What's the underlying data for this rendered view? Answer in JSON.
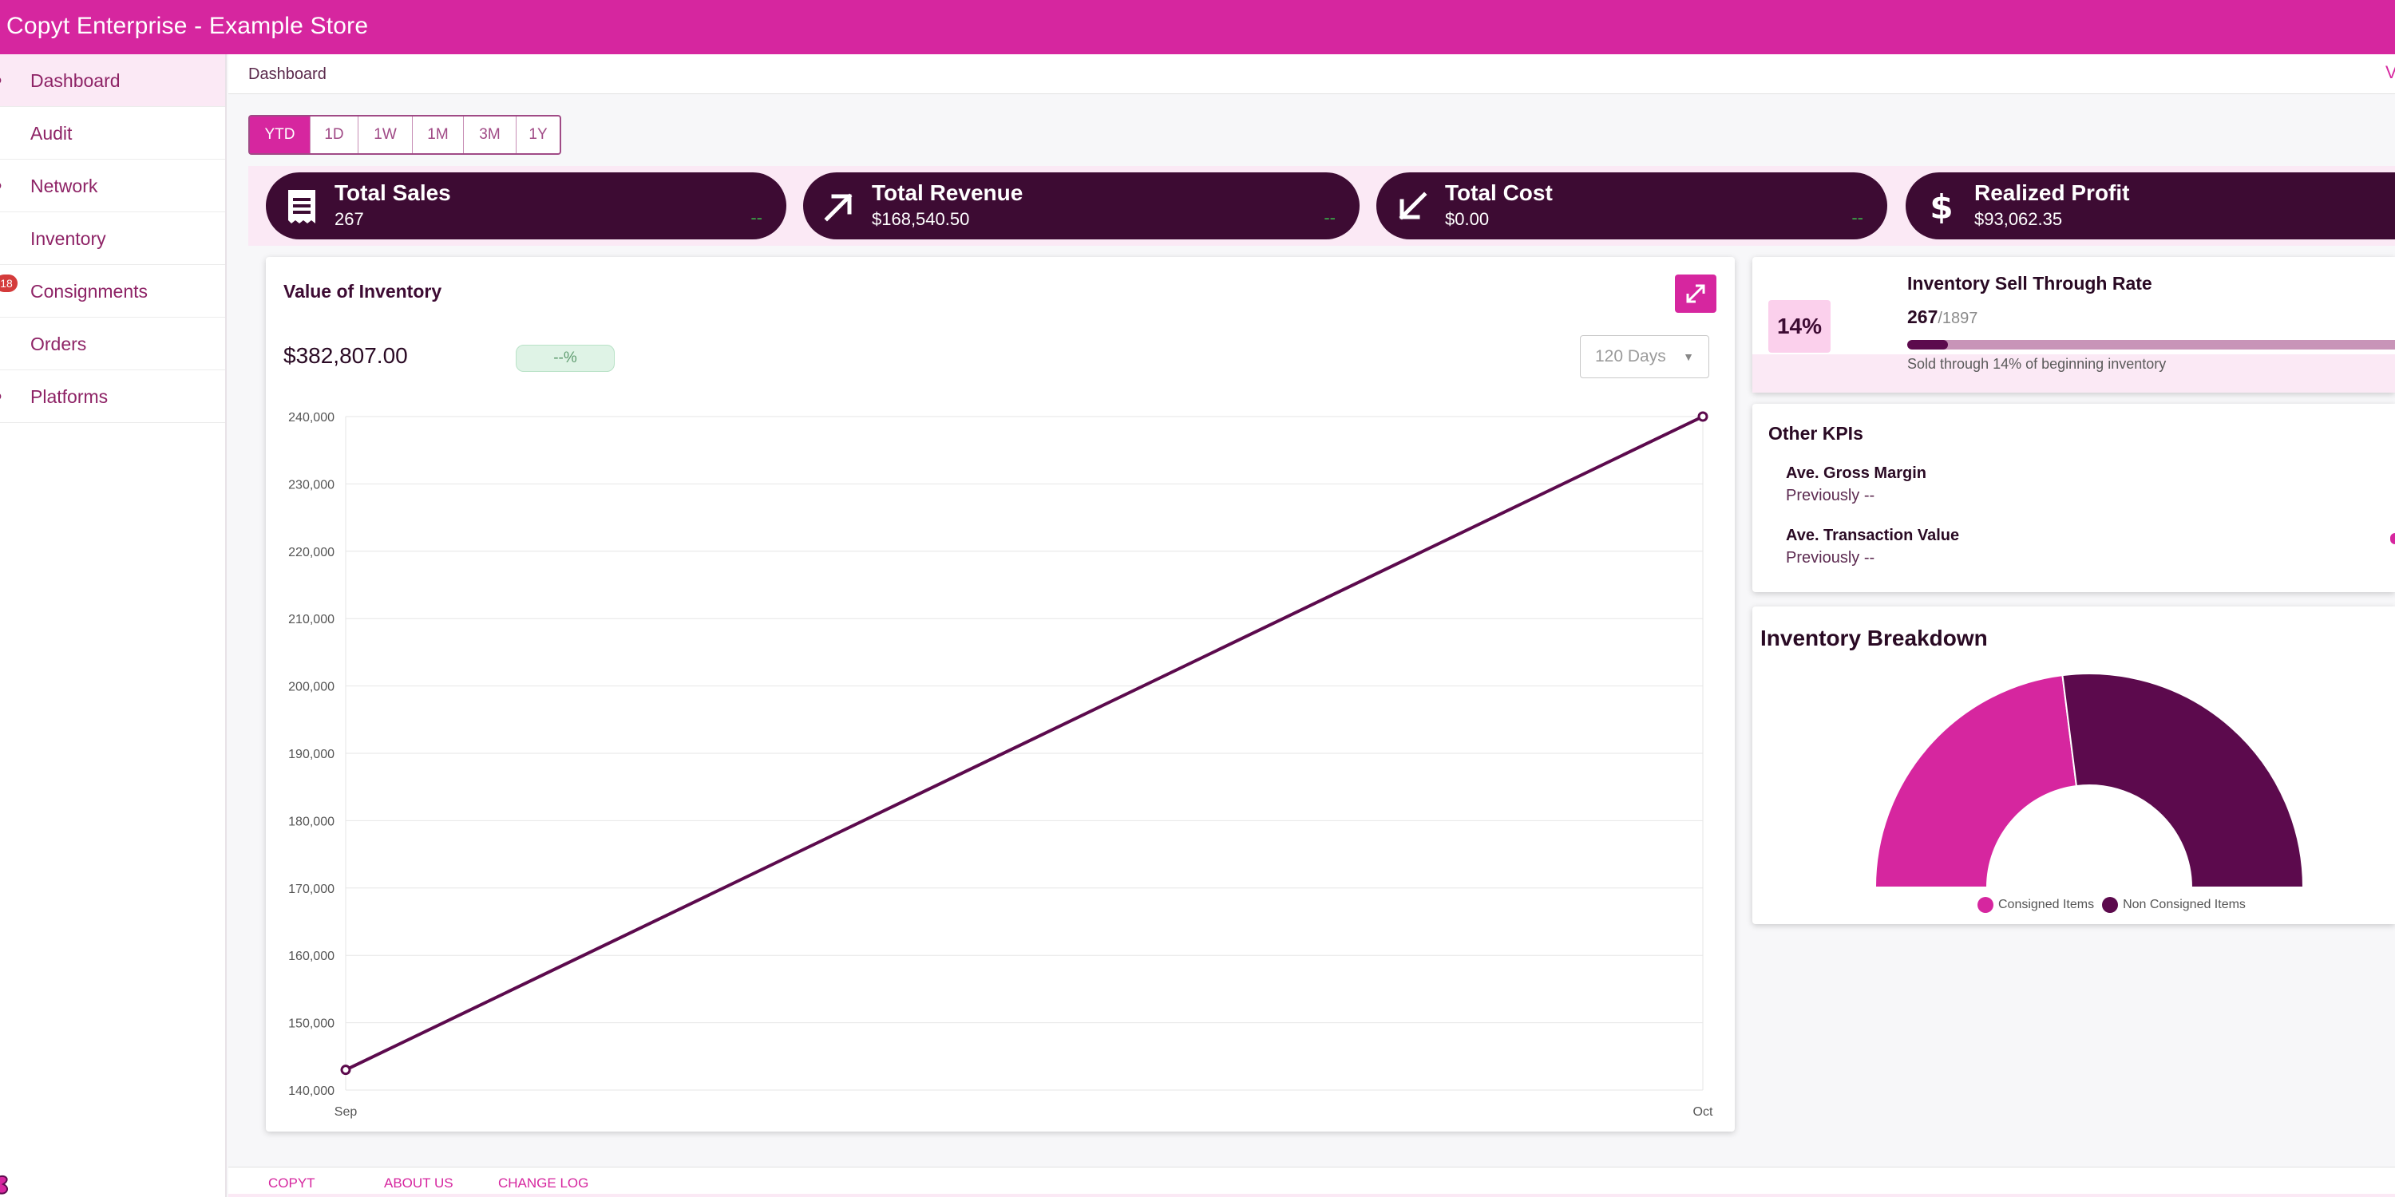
{
  "app": {
    "title": "Copyt Enterprise - Example Store"
  },
  "sidebar": {
    "items": [
      {
        "label": "Dashboard",
        "icon": "dashboard-icon",
        "active": true
      },
      {
        "label": "Audit",
        "icon": "audit-icon"
      },
      {
        "label": "Network",
        "icon": "network-icon"
      },
      {
        "label": "Inventory",
        "icon": "inventory-icon"
      },
      {
        "label": "Consignments",
        "icon": "consignments-icon",
        "badge": "18"
      },
      {
        "label": "Orders",
        "icon": "orders-icon"
      },
      {
        "label": "Platforms",
        "icon": "platforms-icon"
      }
    ]
  },
  "breadcrumb": {
    "current": "Dashboard"
  },
  "time_ranges": {
    "options": [
      "YTD",
      "1D",
      "1W",
      "1M",
      "3M",
      "1Y"
    ],
    "selected": "YTD"
  },
  "kpis": [
    {
      "title": "Total Sales",
      "value": "267",
      "delta": "--",
      "icon": "receipt-icon"
    },
    {
      "title": "Total Revenue",
      "value": "$168,540.50",
      "delta": "--",
      "icon": "arrow-up-right-icon"
    },
    {
      "title": "Total Cost",
      "value": "$0.00",
      "delta": "--",
      "icon": "arrow-down-left-icon"
    },
    {
      "title": "Realized Profit",
      "value": "$93,062.35",
      "delta": "",
      "icon": "dollar-icon"
    }
  ],
  "value_of_inventory": {
    "title": "Value of Inventory",
    "value": "$382,807.00",
    "change": "--%",
    "period": "120 Days"
  },
  "chart_data": {
    "type": "line",
    "title": "Value of Inventory",
    "x": [
      "Sep",
      "Oct"
    ],
    "series": [
      {
        "values": [
          143000,
          240000
        ]
      }
    ],
    "ylim": [
      140000,
      240000
    ],
    "yticks": [
      140000,
      150000,
      160000,
      170000,
      180000,
      190000,
      200000,
      210000,
      220000,
      230000,
      240000
    ],
    "ytick_labels": [
      "140,000",
      "150,000",
      "160,000",
      "170,000",
      "180,000",
      "190,000",
      "200,000",
      "210,000",
      "220,000",
      "230,000",
      "240,000"
    ],
    "xlabel": "",
    "ylabel": "",
    "grid": true,
    "colors": {
      "line": "#5c0a4d"
    }
  },
  "sell_through": {
    "title": "Inventory Sell Through Rate",
    "percent_label": "14%",
    "sold": "267",
    "total": "/1897",
    "fraction": 0.14,
    "note": "Sold through 14% of beginning inventory"
  },
  "other_kpis": {
    "title": "Other KPIs",
    "items": [
      {
        "label": "Ave. Gross Margin",
        "previous": "Previously --"
      },
      {
        "label": "Ave. Transaction Value",
        "previous": "Previously --"
      }
    ]
  },
  "inventory_breakdown": {
    "title": "Inventory Breakdown",
    "chart": {
      "type": "pie",
      "series": [
        {
          "name": "Consigned Items",
          "share": 0.46,
          "color": "#d6269f"
        },
        {
          "name": "Non Consigned Items",
          "share": 0.54,
          "color": "#5c0a4d"
        }
      ]
    }
  },
  "footer": {
    "links": [
      "COPYT",
      "ABOUT US",
      "CHANGE LOG"
    ]
  },
  "colors": {
    "brand": "#d6269f",
    "dark": "#3d0b33",
    "accent_dark": "#5c0a4d"
  }
}
